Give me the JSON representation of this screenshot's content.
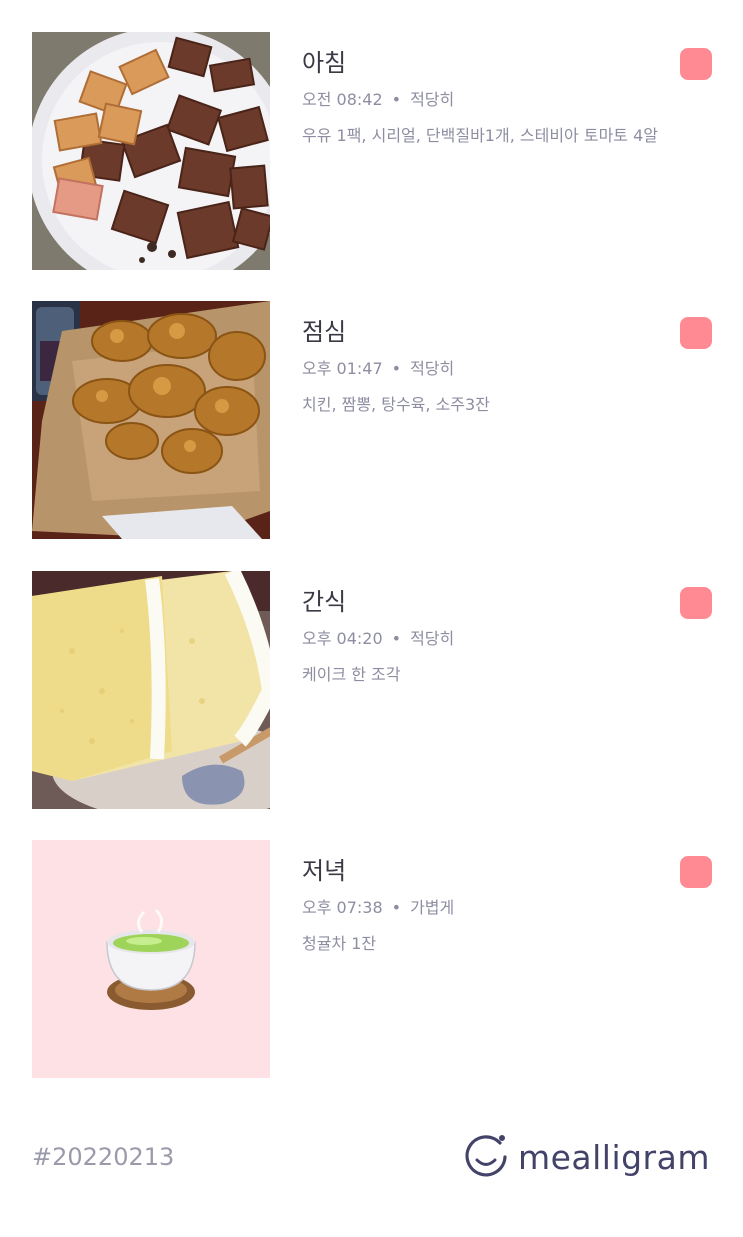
{
  "meals": [
    {
      "title": "아침",
      "time": "오전 08:42",
      "amount": "적당히",
      "description": "우유 1팩, 시리얼, 단백질바1개, 스테비아 토마토 4알",
      "photo": "cereal-photo"
    },
    {
      "title": "점심",
      "time": "오후 01:47",
      "amount": "적당히",
      "description": "치킨, 짬뽕, 탕수육, 소주3잔",
      "photo": "fried-chicken-photo"
    },
    {
      "title": "간식",
      "time": "오후 04:20",
      "amount": "적당히",
      "description": "케이크 한 조각",
      "photo": "cake-photo"
    },
    {
      "title": "저녁",
      "time": "오후 07:38",
      "amount": "가볍게",
      "description": "청귤차 1잔",
      "photo": "tea-cup-emoji"
    }
  ],
  "separator": "•",
  "footer": {
    "date_tag": "#20220213",
    "brand_name": "mealligram",
    "brand_icon": "smile-circle-icon"
  },
  "colors": {
    "marker": "#ff8a94",
    "tea_background": "#fde1e4",
    "brand": "#43436a"
  }
}
